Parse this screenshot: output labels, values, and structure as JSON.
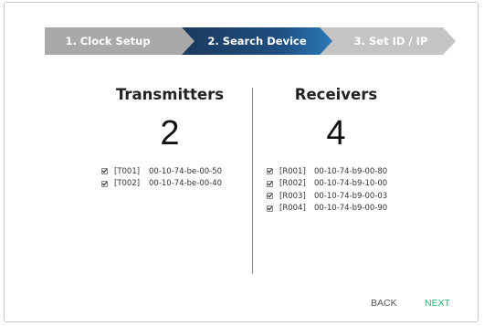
{
  "stepper": {
    "steps": [
      {
        "label": "1. Clock Setup",
        "state": "completed"
      },
      {
        "label": "2. Search Device",
        "state": "active"
      },
      {
        "label": "3. Set ID / IP",
        "state": "pending"
      }
    ]
  },
  "transmitters": {
    "title": "Transmitters",
    "count": "2",
    "items": [
      {
        "id": "[T001]",
        "mac": "00-10-74-be-00-50",
        "checked": true
      },
      {
        "id": "[T002]",
        "mac": "00-10-74-be-00-40",
        "checked": true
      }
    ]
  },
  "receivers": {
    "title": "Receivers",
    "count": "4",
    "items": [
      {
        "id": "[R001]",
        "mac": "00-10-74-b9-00-80",
        "checked": true
      },
      {
        "id": "[R002]",
        "mac": "00-10-74-b9-10-00",
        "checked": true
      },
      {
        "id": "[R003]",
        "mac": "00-10-74-b9-00-03",
        "checked": true
      },
      {
        "id": "[R004]",
        "mac": "00-10-74-b9-00-90",
        "checked": true
      }
    ]
  },
  "footer": {
    "back_label": "BACK",
    "next_label": "NEXT"
  },
  "colors": {
    "active_step": "#1f4e80",
    "completed_step": "#a9a9a9",
    "pending_step": "#c4c4c4",
    "next_accent": "#2bb673"
  }
}
